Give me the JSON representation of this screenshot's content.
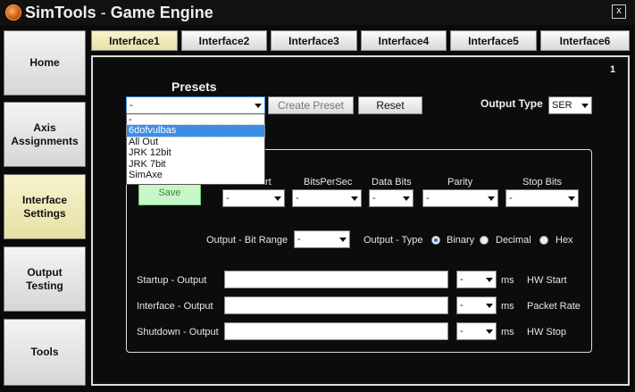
{
  "window": {
    "title_app": "SimTools",
    "title_sep": " - ",
    "title_page": "Game Engine",
    "close_label": "x"
  },
  "sidebar": {
    "items": [
      {
        "label": "Home"
      },
      {
        "label": "Axis Assignments"
      },
      {
        "label": "Interface Settings",
        "active": true
      },
      {
        "label": "Output Testing"
      },
      {
        "label": "Tools"
      }
    ]
  },
  "tabs": [
    {
      "label": "Interface1",
      "active": true
    },
    {
      "label": "Interface2"
    },
    {
      "label": "Interface3"
    },
    {
      "label": "Interface4"
    },
    {
      "label": "Interface5"
    },
    {
      "label": "Interface6"
    }
  ],
  "panel": {
    "page_number": "1",
    "presets": {
      "title": "Presets",
      "selected": "-",
      "options": [
        "-",
        "6dofvulbas",
        "All Out",
        "JRK 12bit",
        "JRK 7bit",
        "SimAxe"
      ],
      "highlighted_index": 1,
      "create_label": "Create Preset",
      "reset_label": "Reset"
    },
    "output_type": {
      "label": "Output Type",
      "value": "SER"
    },
    "save_label": "Save",
    "serial": {
      "headers": [
        "ComPort",
        "BitsPerSec",
        "Data Bits",
        "Parity",
        "Stop Bits"
      ],
      "header_comport_visible": "rt",
      "values": [
        "-",
        "-",
        "-",
        "-",
        "-"
      ]
    },
    "bit_range": {
      "label": "Output - Bit Range",
      "value": "-"
    },
    "output_format": {
      "label": "Output - Type",
      "options": [
        "Binary",
        "Decimal",
        "Hex"
      ],
      "selected": "Binary"
    },
    "rows": [
      {
        "label": "Startup - Output",
        "ms_value": "-",
        "ms_unit": "ms",
        "right_label": "HW Start"
      },
      {
        "label": "Interface - Output",
        "ms_value": "-",
        "ms_unit": "ms",
        "right_label": "Packet Rate"
      },
      {
        "label": "Shutdown - Output",
        "ms_value": "-",
        "ms_unit": "ms",
        "right_label": "HW Stop"
      }
    ]
  }
}
